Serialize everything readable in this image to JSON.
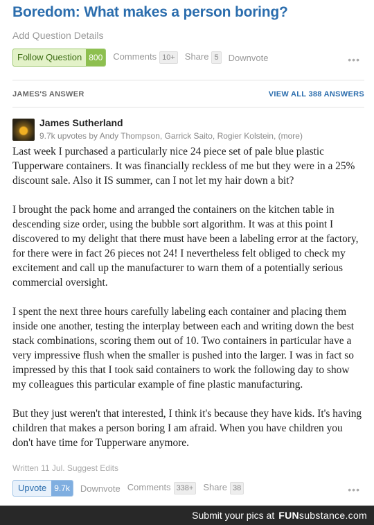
{
  "question": {
    "title": "Boredom: What makes a person boring?",
    "add_details": "Add Question Details",
    "follow_label": "Follow Question",
    "follow_count": "800",
    "comments_label": "Comments",
    "comments_count": "10+",
    "share_label": "Share",
    "share_count": "5",
    "downvote_label": "Downvote",
    "more": "•••"
  },
  "section": {
    "answer_label": "JAMES'S ANSWER",
    "view_all": "VIEW ALL 388 ANSWERS"
  },
  "answer": {
    "author": "James Sutherland",
    "upvoters": "9.7k upvotes by Andy Thompson, Garrick Saito, Rogier Kolstein, (more)",
    "paragraphs": [
      "Last week I purchased a particularly nice 24 piece set of pale blue plastic Tupperware containers. It was financially reckless of me but they were in a 25% discount sale. Also it IS summer, can I not let my hair down a bit?",
      "I brought the pack home and arranged the containers on the kitchen table in descending size order, using the bubble sort algorithm. It was at this point I discovered to my delight that there must have been a labeling error at the factory, for there were in fact 26 pieces not 24! I nevertheless felt obliged to check my excitement and call up the manufacturer to warn them of a potentially serious commercial oversight.",
      "I spent the next three hours carefully labeling each container and placing them inside one another, testing the interplay between each and writing down the best stack combinations, scoring them out of 10. Two containers in particular have a very impressive flush when the smaller is pushed into the larger. I was in fact so impressed by this that I took said containers to work the following day to show my colleagues this particular example of fine plastic manufacturing.",
      "But they just weren't that interested, I think it's because they have kids. It's having children that makes a person boring I am afraid. When you have children you don't have time for Tupperware anymore."
    ],
    "written": "Written 11 Jul. Suggest Edits",
    "upvote_label": "Upvote",
    "upvote_count": "9.7k",
    "downvote_label": "Downvote",
    "comments_label": "Comments",
    "comments_count": "338+",
    "share_label": "Share",
    "share_count": "38",
    "more": "•••"
  },
  "footer": {
    "submit_text": "Submit your pics at",
    "brand_bold": "FUN",
    "brand_light": "substance",
    "brand_suffix": ".com"
  }
}
